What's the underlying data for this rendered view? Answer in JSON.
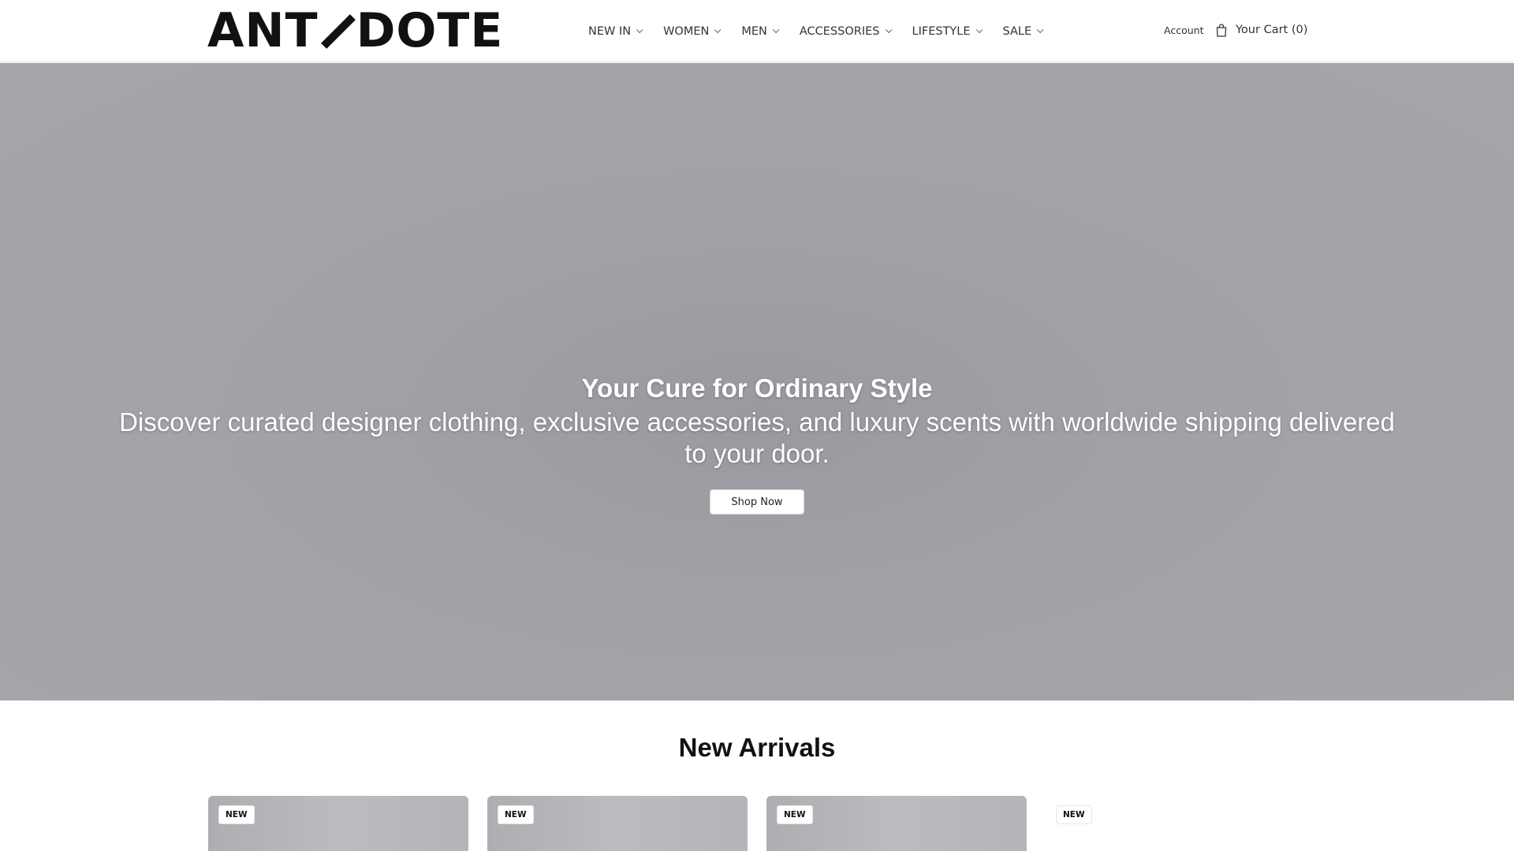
{
  "header": {
    "logo_text": "ANTIDOTE",
    "nav": [
      {
        "label": "NEW IN"
      },
      {
        "label": "WOMEN"
      },
      {
        "label": "MEN"
      },
      {
        "label": "ACCESSORIES"
      },
      {
        "label": "LIFESTYLE"
      },
      {
        "label": "SALE"
      }
    ],
    "account_label": "Account",
    "cart_label": "Your Cart (0)"
  },
  "hero": {
    "title": "Your Cure for Ordinary Style",
    "subtitle": "Discover curated designer clothing, exclusive accessories, and luxury scents with worldwide shipping delivered to your door.",
    "cta_label": "Shop Now"
  },
  "new_arrivals": {
    "title": "New Arrivals",
    "products": [
      {
        "badge": "NEW"
      },
      {
        "badge": "NEW"
      },
      {
        "badge": "NEW"
      },
      {
        "badge": "NEW"
      }
    ]
  },
  "icons": {
    "cart": "shopping-bag-icon",
    "chevron": "chevron-down-icon"
  }
}
